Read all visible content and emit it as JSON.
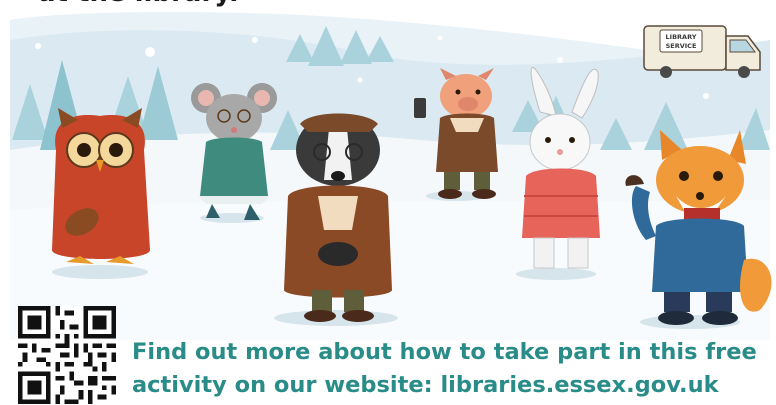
{
  "header": {
    "clipped_text": "at the library."
  },
  "van": {
    "sign_line1": "LIBRARY",
    "sign_line2": "SERVICE"
  },
  "characters": [
    "owl-in-hoodie",
    "mouse-skater",
    "badger-in-coat",
    "pig-with-phone",
    "rabbit-in-puffer",
    "fox-waving"
  ],
  "qr": {
    "icon": "qr-code-icon"
  },
  "cta": {
    "line1": "Find out more about how to take part in this free",
    "line2": "activity on our website: libraries.essex.gov.uk"
  },
  "colors": {
    "teal": "#2a8c88",
    "snow": "#f3f8fb",
    "sky": "#e6f0f6"
  }
}
